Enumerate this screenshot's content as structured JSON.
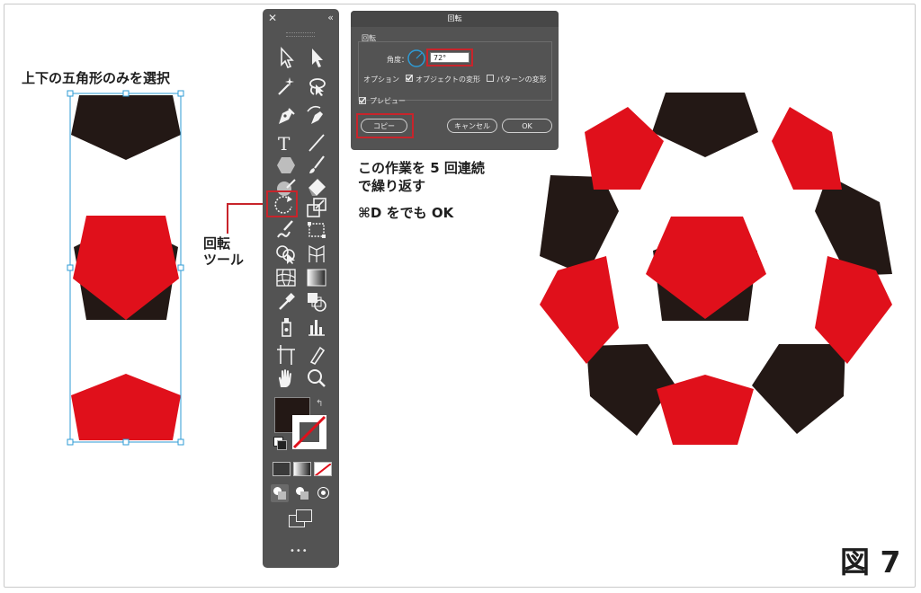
{
  "caption_select": "上下の五角形のみを選択",
  "tool_label_line1": "回転",
  "tool_label_line2": "ツール",
  "instruction_line1": "この作業を 5 回連続",
  "instruction_line2": "で繰り返す",
  "shortcut_key": "⌘",
  "shortcut_text": "D をでも OK",
  "figure_label": "図 7",
  "dialog": {
    "title": "回転",
    "group_label": "回転",
    "angle_label": "角度：",
    "angle_value": "72°",
    "options_label": "オプション",
    "transform_objects_label": "オブジェクトの変形",
    "transform_patterns_label": "パターンの変形",
    "preview_label": "プレビュー",
    "copy_button": "コピー",
    "cancel_button": "キャンセル",
    "ok_button": "OK"
  },
  "toolbar": {
    "close_glyph": "✕",
    "collapse_glyph": "«",
    "more_glyph": "•••"
  },
  "colors": {
    "red": "#e0101b",
    "black": "#231815",
    "highlight": "#c8242b",
    "selection": "#2d9bd6",
    "panel": "#535353"
  },
  "icons": [
    "selection-tool-icon",
    "direct-selection-tool-icon",
    "magic-wand-icon",
    "lasso-icon",
    "pen-tool-icon",
    "curvature-tool-icon",
    "type-tool-icon",
    "line-tool-icon",
    "polygon-tool-icon",
    "paintbrush-icon",
    "blob-brush-icon",
    "eraser-icon",
    "rotate-tool-icon",
    "scale-tool-icon",
    "warp-tool-icon",
    "free-transform-icon",
    "shape-builder-icon",
    "perspective-grid-icon",
    "mesh-tool-icon",
    "gradient-tool-icon",
    "eyedropper-icon",
    "blend-tool-icon",
    "symbol-sprayer-icon",
    "column-graph-icon",
    "artboard-tool-icon",
    "slice-tool-icon",
    "hand-tool-icon",
    "zoom-tool-icon"
  ]
}
